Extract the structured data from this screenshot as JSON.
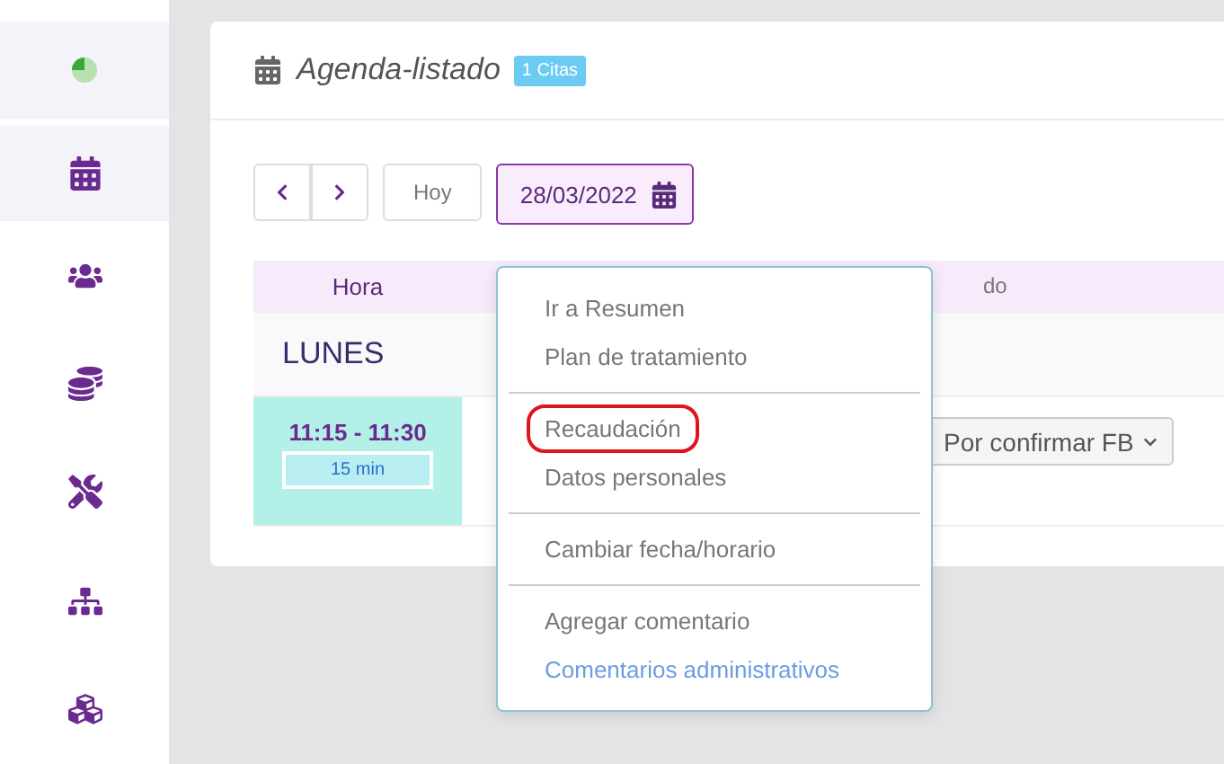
{
  "sidebar": {
    "items": [
      {
        "kind": "calendar",
        "selected": true
      },
      {
        "kind": "users",
        "selected": false
      },
      {
        "kind": "coins",
        "selected": false
      },
      {
        "kind": "tools",
        "selected": false
      },
      {
        "kind": "sitemap",
        "selected": false
      },
      {
        "kind": "cubes",
        "selected": false
      }
    ]
  },
  "panel": {
    "title": "Agenda-listado",
    "badge": "1 Citas"
  },
  "toolbar": {
    "today": "Hoy",
    "date": "28/03/2022"
  },
  "table": {
    "columns": [
      "Hora",
      "do"
    ],
    "day": "LUNES",
    "rows": [
      {
        "time": "11:15 - 11:30",
        "duration": "15 min",
        "status": "Por confirmar FB"
      }
    ]
  },
  "menu": {
    "items": [
      {
        "kind": "item",
        "label": "Ir a Resumen",
        "highlighted": false
      },
      {
        "kind": "item",
        "label": "Plan de tratamiento",
        "highlighted": false
      },
      {
        "kind": "divider"
      },
      {
        "kind": "item",
        "label": "Recaudación",
        "highlighted": true
      },
      {
        "kind": "item",
        "label": "Datos personales",
        "highlighted": false
      },
      {
        "kind": "divider"
      },
      {
        "kind": "item",
        "label": "Cambiar fecha/horario",
        "highlighted": false
      },
      {
        "kind": "divider"
      },
      {
        "kind": "item",
        "label": "Agregar comentario",
        "highlighted": false
      },
      {
        "kind": "link",
        "label": "Comentarios administrativos",
        "highlighted": false
      }
    ]
  }
}
